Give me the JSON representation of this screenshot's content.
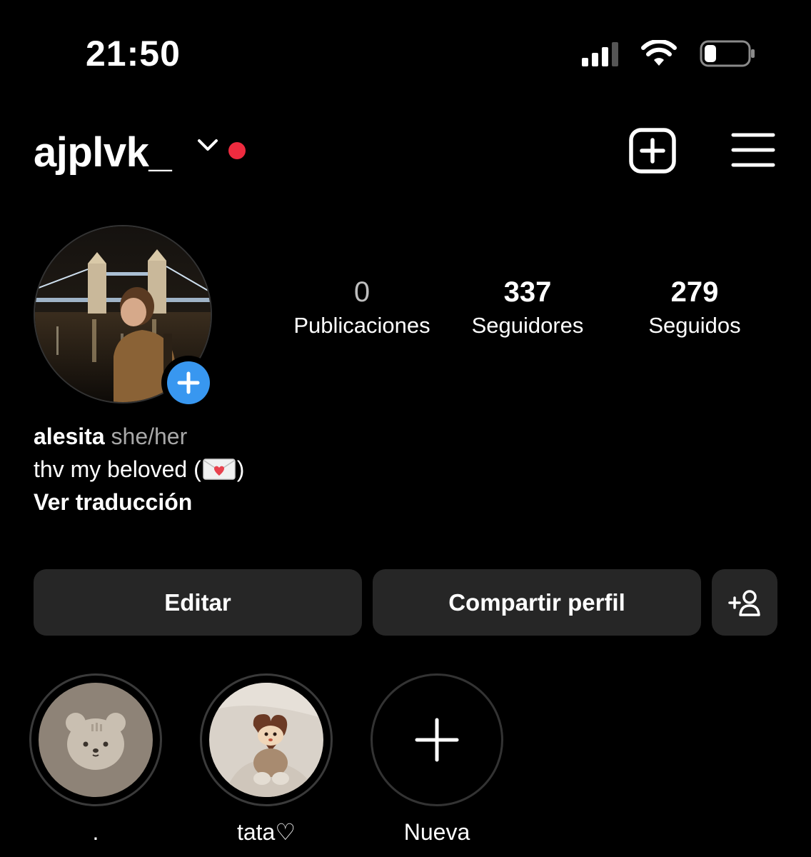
{
  "status_bar": {
    "time": "21:50",
    "signal_icon": "cellular-signal-icon",
    "wifi_icon": "wifi-icon",
    "battery_icon": "battery-low-icon",
    "battery_level": 0.2
  },
  "header": {
    "username": "ajplvk_",
    "chevron_icon": "chevron-down-icon",
    "notification_dot_color": "#ee2b3f",
    "new_post_icon": "plus-square-icon",
    "menu_icon": "hamburger-menu-icon"
  },
  "profile": {
    "avatar_icon": "profile-photo",
    "add_story_icon": "plus-circle-icon",
    "accent_color": "#3897f0"
  },
  "stats": [
    {
      "value": "0",
      "label": "Publicaciones"
    },
    {
      "value": "337",
      "label": "Seguidores"
    },
    {
      "value": "279",
      "label": "Seguidos"
    }
  ],
  "bio": {
    "name": "alesita",
    "pronouns": "she/her",
    "text_before": "thv my beloved (",
    "text_after": ")",
    "emoji_icon": "love-letter-icon",
    "translate": "Ver traducción"
  },
  "actions": {
    "edit": "Editar",
    "share": "Compartir perfil",
    "add_user_icon": "add-person-icon"
  },
  "highlights": [
    {
      "label": ".",
      "icon": "bear-icon"
    },
    {
      "label": "tata♡",
      "icon": "plush-toy-photo"
    },
    {
      "label": "Nueva",
      "icon": "plus-icon"
    }
  ]
}
